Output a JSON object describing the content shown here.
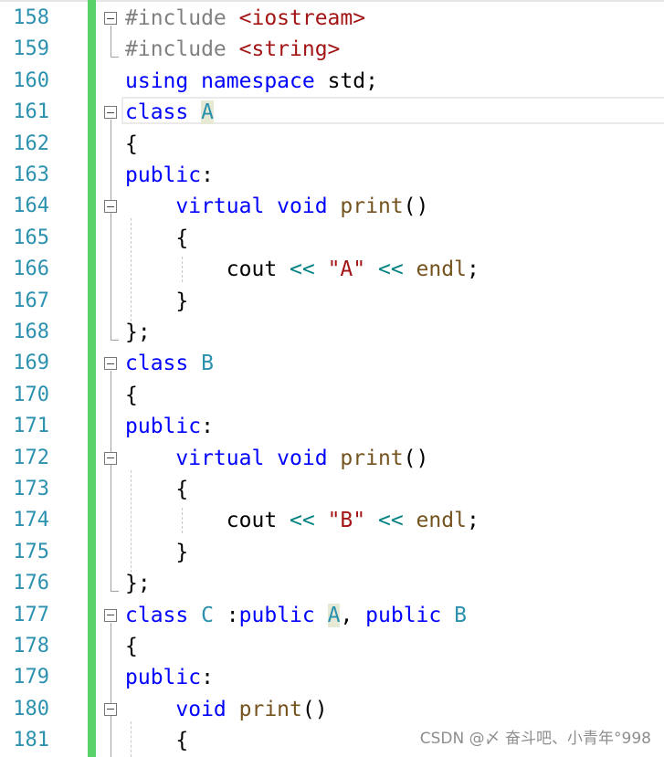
{
  "editor": {
    "lines": [
      {
        "number": "158",
        "tokens": [
          {
            "t": "#include ",
            "c": "preproc"
          },
          {
            "t": "<iostream>",
            "c": "include-path"
          }
        ]
      },
      {
        "number": "159",
        "tokens": [
          {
            "t": "#include ",
            "c": "preproc"
          },
          {
            "t": "<string>",
            "c": "include-path"
          }
        ]
      },
      {
        "number": "160",
        "tokens": [
          {
            "t": "using namespace ",
            "c": "keyword"
          },
          {
            "t": "std;",
            "c": "ident"
          }
        ]
      },
      {
        "number": "161",
        "tokens": [
          {
            "t": "class ",
            "c": "keyword"
          },
          {
            "t": "A",
            "c": "type",
            "hl": true
          }
        ]
      },
      {
        "number": "162",
        "tokens": [
          {
            "t": "{",
            "c": "punct"
          }
        ]
      },
      {
        "number": "163",
        "tokens": [
          {
            "t": "public",
            "c": "keyword"
          },
          {
            "t": ":",
            "c": "punct"
          }
        ]
      },
      {
        "number": "164",
        "tokens": [
          {
            "t": "    ",
            "c": "punct"
          },
          {
            "t": "virtual void ",
            "c": "keyword"
          },
          {
            "t": "print",
            "c": "func"
          },
          {
            "t": "()",
            "c": "punct"
          }
        ]
      },
      {
        "number": "165",
        "tokens": [
          {
            "t": "    {",
            "c": "punct"
          }
        ]
      },
      {
        "number": "166",
        "tokens": [
          {
            "t": "        cout ",
            "c": "ident"
          },
          {
            "t": "<<",
            "c": "op"
          },
          {
            "t": " ",
            "c": "punct"
          },
          {
            "t": "\"A\"",
            "c": "string"
          },
          {
            "t": " ",
            "c": "punct"
          },
          {
            "t": "<<",
            "c": "op"
          },
          {
            "t": " ",
            "c": "punct"
          },
          {
            "t": "endl",
            "c": "func"
          },
          {
            "t": ";",
            "c": "punct"
          }
        ]
      },
      {
        "number": "167",
        "tokens": [
          {
            "t": "    }",
            "c": "punct"
          }
        ]
      },
      {
        "number": "168",
        "tokens": [
          {
            "t": "};",
            "c": "punct"
          }
        ]
      },
      {
        "number": "169",
        "tokens": [
          {
            "t": "class ",
            "c": "keyword"
          },
          {
            "t": "B",
            "c": "type"
          }
        ]
      },
      {
        "number": "170",
        "tokens": [
          {
            "t": "{",
            "c": "punct"
          }
        ]
      },
      {
        "number": "171",
        "tokens": [
          {
            "t": "public",
            "c": "keyword"
          },
          {
            "t": ":",
            "c": "punct"
          }
        ]
      },
      {
        "number": "172",
        "tokens": [
          {
            "t": "    ",
            "c": "punct"
          },
          {
            "t": "virtual void ",
            "c": "keyword"
          },
          {
            "t": "print",
            "c": "func"
          },
          {
            "t": "()",
            "c": "punct"
          }
        ]
      },
      {
        "number": "173",
        "tokens": [
          {
            "t": "    {",
            "c": "punct"
          }
        ]
      },
      {
        "number": "174",
        "tokens": [
          {
            "t": "        cout ",
            "c": "ident"
          },
          {
            "t": "<<",
            "c": "op"
          },
          {
            "t": " ",
            "c": "punct"
          },
          {
            "t": "\"B\"",
            "c": "string"
          },
          {
            "t": " ",
            "c": "punct"
          },
          {
            "t": "<<",
            "c": "op"
          },
          {
            "t": " ",
            "c": "punct"
          },
          {
            "t": "endl",
            "c": "func"
          },
          {
            "t": ";",
            "c": "punct"
          }
        ]
      },
      {
        "number": "175",
        "tokens": [
          {
            "t": "    }",
            "c": "punct"
          }
        ]
      },
      {
        "number": "176",
        "tokens": [
          {
            "t": "};",
            "c": "punct"
          }
        ]
      },
      {
        "number": "177",
        "tokens": [
          {
            "t": "class ",
            "c": "keyword"
          },
          {
            "t": "C",
            "c": "type"
          },
          {
            "t": " :",
            "c": "punct"
          },
          {
            "t": "public ",
            "c": "keyword"
          },
          {
            "t": "A",
            "c": "type",
            "hl": true
          },
          {
            "t": ", ",
            "c": "punct"
          },
          {
            "t": "public ",
            "c": "keyword"
          },
          {
            "t": "B",
            "c": "type"
          }
        ]
      },
      {
        "number": "178",
        "tokens": [
          {
            "t": "{",
            "c": "punct"
          }
        ]
      },
      {
        "number": "179",
        "tokens": [
          {
            "t": "public",
            "c": "keyword"
          },
          {
            "t": ":",
            "c": "punct"
          }
        ]
      },
      {
        "number": "180",
        "tokens": [
          {
            "t": "    ",
            "c": "punct"
          },
          {
            "t": "void ",
            "c": "keyword"
          },
          {
            "t": "print",
            "c": "func"
          },
          {
            "t": "()",
            "c": "punct"
          }
        ]
      },
      {
        "number": "181",
        "tokens": [
          {
            "t": "    {",
            "c": "punct"
          }
        ]
      }
    ],
    "fold_markers": [
      "158",
      "161",
      "164",
      "169",
      "172",
      "177",
      "180"
    ],
    "colors": {
      "line_number": "#2b91af",
      "keyword": "#0000ff",
      "type": "#2b91af",
      "string": "#a31515",
      "function": "#74531f",
      "operator": "#008080",
      "change_bar": "#57d36a"
    }
  },
  "watermark": {
    "text": "CSDN @〆 奋斗吧、小青年°998"
  }
}
